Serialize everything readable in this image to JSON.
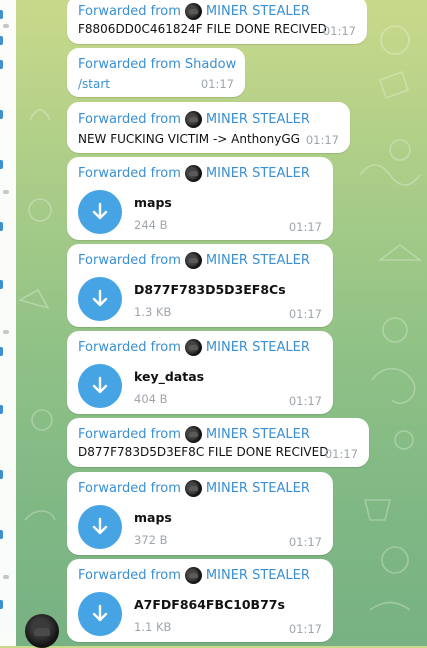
{
  "colors": {
    "accent": "#3a8fd3",
    "file_icon": "#46a4e4",
    "bubble": "#ffffff",
    "time": "#9ea6ad"
  },
  "messages": [
    {
      "forward_prefix": "Forwarded from",
      "sender": "MINER STEALER",
      "text": "F8806DD0C461824F FILE DONE RECIVED",
      "time": "01:17"
    },
    {
      "forward_prefix": "Forwarded from",
      "sender": "Shadow",
      "text": "/start",
      "time": "01:17"
    },
    {
      "forward_prefix": "Forwarded from",
      "sender": "MINER STEALER",
      "text": "NEW FUCKING VICTIM -> AnthonyGG",
      "time": "01:17"
    },
    {
      "forward_prefix": "Forwarded from",
      "sender": "MINER STEALER",
      "file_name": "maps",
      "file_size": "244 B",
      "time": "01:17",
      "icon": "download-arrow-icon"
    },
    {
      "forward_prefix": "Forwarded from",
      "sender": "MINER STEALER",
      "file_name": "D877F783D5D3EF8Cs",
      "file_size": "1.3 KB",
      "time": "01:17",
      "icon": "download-arrow-icon"
    },
    {
      "forward_prefix": "Forwarded from",
      "sender": "MINER STEALER",
      "file_name": "key_datas",
      "file_size": "404 B",
      "time": "01:17",
      "icon": "download-arrow-icon"
    },
    {
      "forward_prefix": "Forwarded from",
      "sender": "MINER STEALER",
      "text": "D877F783D5D3EF8C FILE DONE RECIVED",
      "time": "01:17"
    },
    {
      "forward_prefix": "Forwarded from",
      "sender": "MINER STEALER",
      "file_name": "maps",
      "file_size": "372 B",
      "time": "01:17",
      "icon": "download-arrow-icon"
    },
    {
      "forward_prefix": "Forwarded from",
      "sender": "MINER STEALER",
      "file_name": "A7FDF864FBC10B77s",
      "file_size": "1.1 KB",
      "time": "01:17",
      "icon": "download-arrow-icon"
    }
  ]
}
